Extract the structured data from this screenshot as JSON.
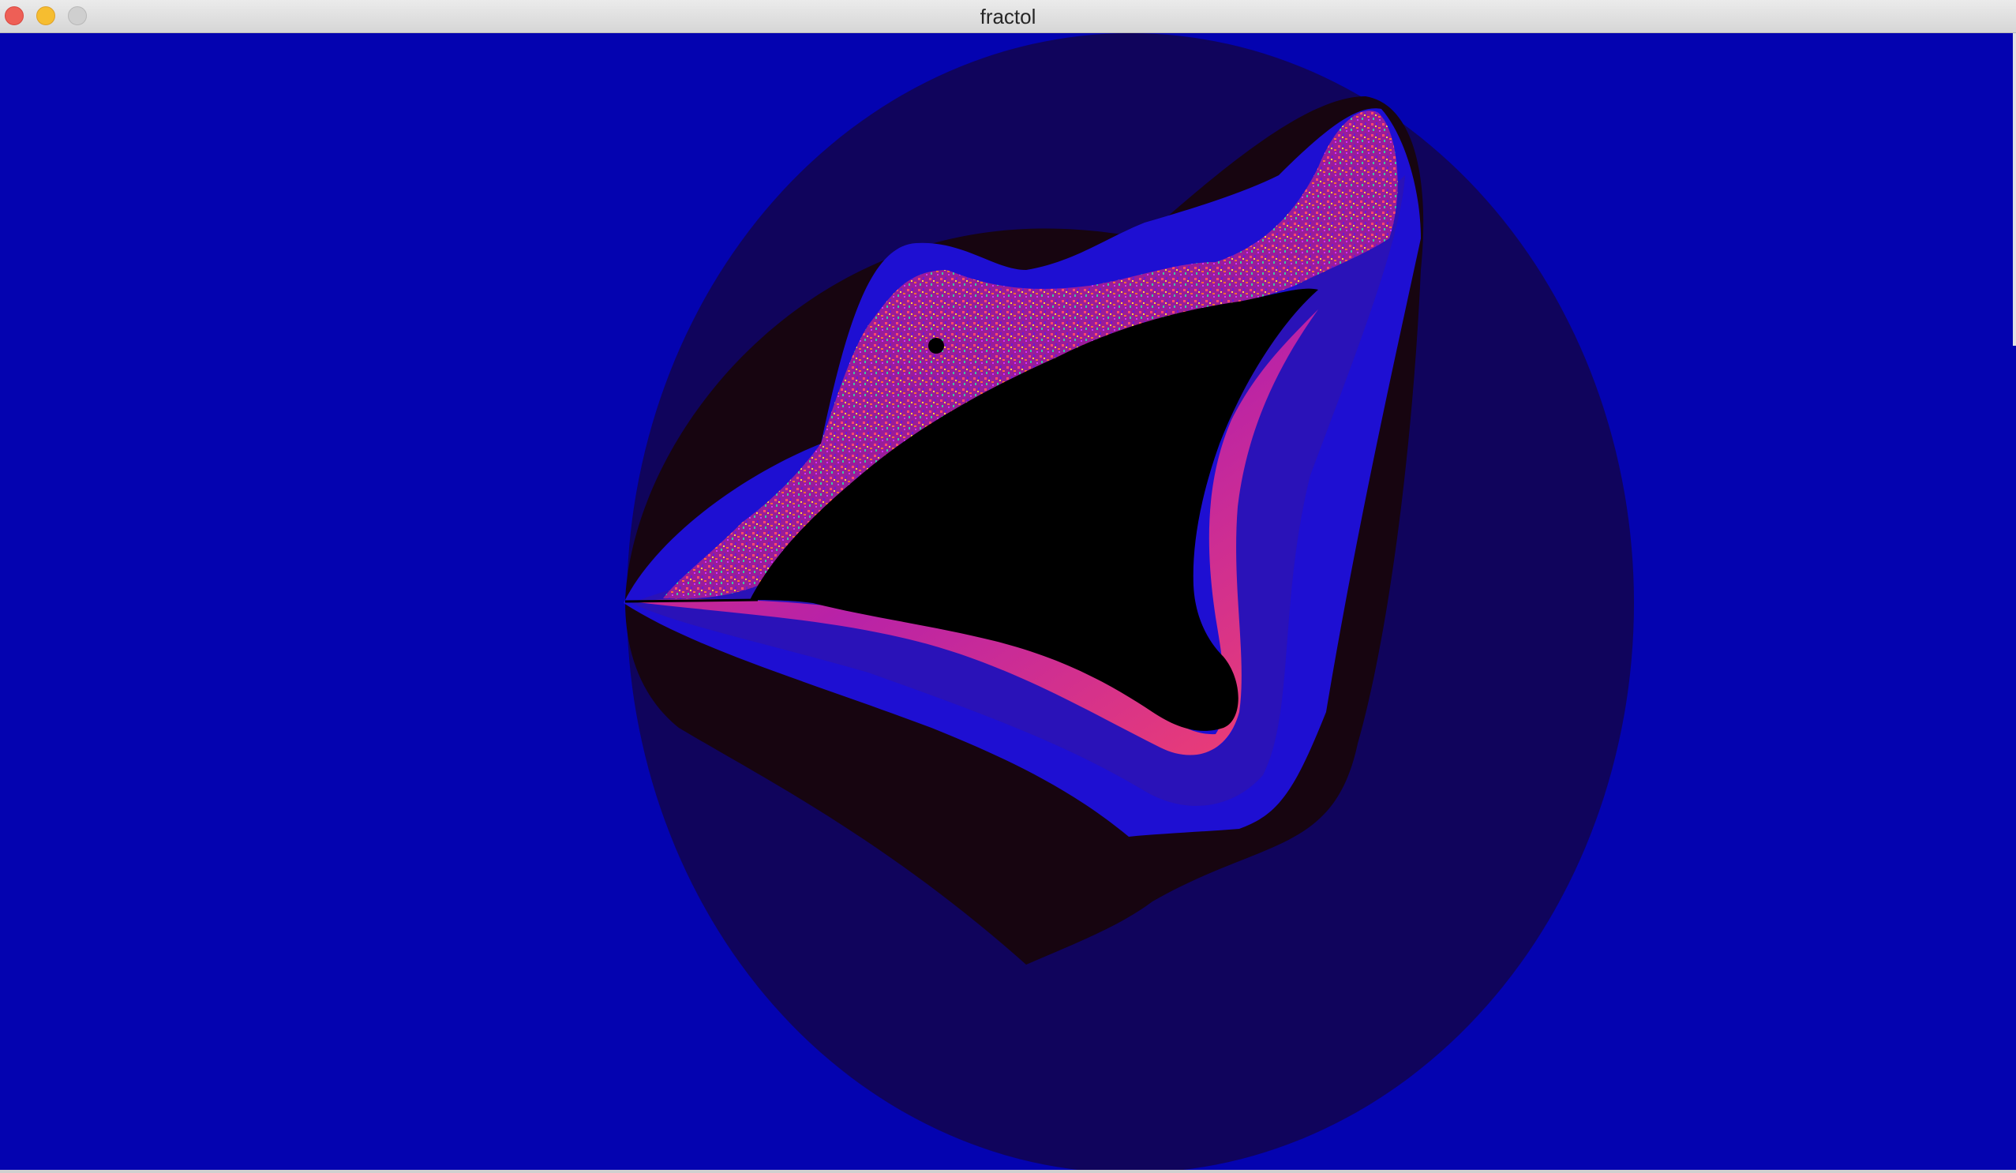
{
  "window": {
    "title": "fractol"
  },
  "controls": {
    "close": "close-button",
    "minimize": "minimize-button",
    "zoom": "zoom-button"
  },
  "colors": {
    "background": "#0403b0",
    "outer_disc": "#10045c",
    "dark_band": "#170510",
    "blue_band": "#1e0fd2",
    "violet_band": "#2a12b8",
    "magenta": "#c0208a",
    "set": "#000000"
  }
}
